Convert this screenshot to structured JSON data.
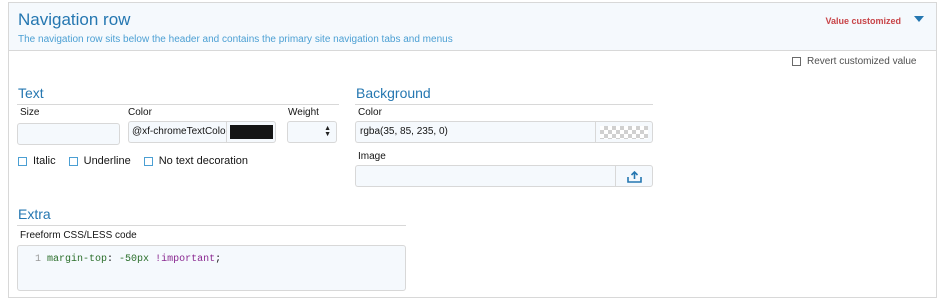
{
  "header": {
    "title": "Navigation row",
    "description": "The navigation row sits below the header and contains the primary site navigation tabs and menus",
    "status": "Value customized",
    "toggle_icon": "caret-down-icon"
  },
  "revert": {
    "label": "Revert customized value",
    "checked": false
  },
  "text_section": {
    "title": "Text",
    "size_label": "Size",
    "size_value": "",
    "color_label": "Color",
    "color_value": "@xf-chromeTextColor",
    "color_swatch": "#151515",
    "weight_label": "Weight",
    "weight_value": "",
    "decorations": [
      {
        "label": "Italic",
        "checked": false
      },
      {
        "label": "Underline",
        "checked": false
      },
      {
        "label": "No text decoration",
        "checked": false
      }
    ]
  },
  "background_section": {
    "title": "Background",
    "color_label": "Color",
    "color_value": "rgba(35, 85, 235, 0)",
    "image_label": "Image",
    "image_value": "",
    "upload_icon": "upload-icon"
  },
  "extra_section": {
    "title": "Extra",
    "code_label": "Freeform CSS/LESS code",
    "line_number": "1",
    "code": {
      "property": "margin-top",
      "colon": ": ",
      "value": "-50px",
      "important": "!important",
      "semicolon": ";"
    }
  },
  "colors": {
    "accent": "#2577b1",
    "description": "#4b9fd3",
    "customized": "#c84448",
    "input_bg": "#f5f9fd"
  }
}
